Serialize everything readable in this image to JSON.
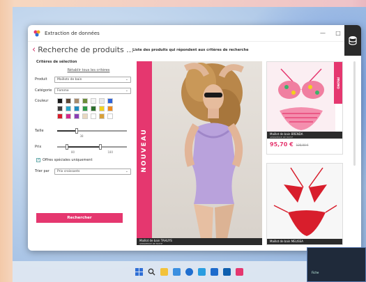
{
  "app": {
    "title": "Extraction de données",
    "page_title": "Recherche de produits ...",
    "results_caption": "Liste des produits qui répondent aux critères de recherche",
    "window_controls": [
      "—",
      "□",
      "✕"
    ]
  },
  "sidebar": {
    "title": "Critères de sélection",
    "reset_link": "Rétablir tous les critères",
    "fields": [
      {
        "label": "Produit",
        "value": "Maillots de bain"
      },
      {
        "label": "Catégorie",
        "value": "Femme"
      }
    ],
    "color_label": "Couleur",
    "colors": [
      "#1a1a1a",
      "#5b4635",
      "#a88a6a",
      "#6b8d3a",
      "#f4f4f4",
      "#e9e9e9",
      "#2f62d9",
      "#3d3d3d",
      "#27a5c9",
      "#1e8bbf",
      "#2e9b4a",
      "#2c6f2c",
      "#f2d21a",
      "#f08a1d",
      "#d81e2c",
      "#d22a8e",
      "#8a3fb5",
      "#e8d8c0",
      "#ffffff",
      "#d9a03a",
      "#ffffff"
    ],
    "size": {
      "label": "Taille",
      "value": "38"
    },
    "price": {
      "label": "Prix",
      "min": "80",
      "max": "180"
    },
    "specials": {
      "label": "Offres spéciales uniquement",
      "checked": true
    },
    "sort": {
      "label": "Trier par",
      "value": "Prix croissants"
    },
    "search_button": "Rechercher"
  },
  "products": [
    {
      "badge": "NOUVEAU",
      "name": "Maillot de bain TAHLIYS",
      "sub": "APPARENCE DE MOTIF"
    },
    {
      "badge": "PROMO",
      "name": "Maillot de bain BRENDA",
      "sub": "APPARENCE DE MOTIF",
      "price": "95,70 €",
      "old_price": "128,00 €"
    },
    {
      "name": "Maillot de bain MELISSA",
      "sub": "APPARENCE DE MOTIF"
    }
  ],
  "overlay": {
    "title": "Fiche"
  }
}
